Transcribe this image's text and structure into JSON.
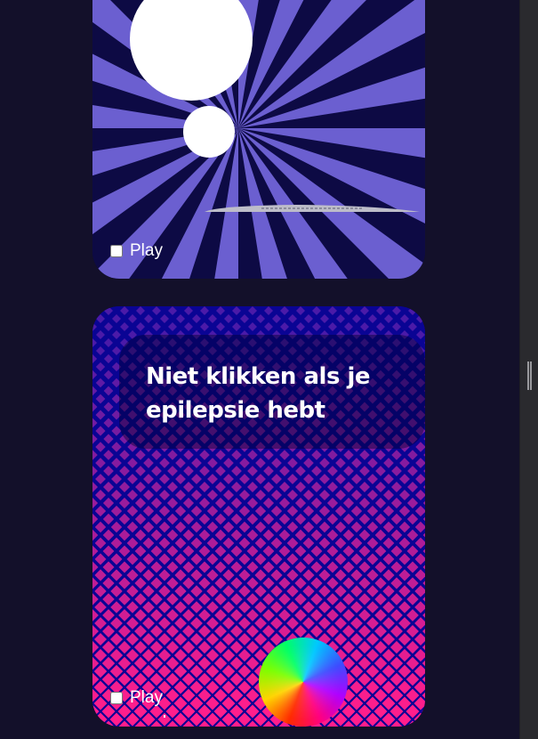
{
  "cards": [
    {
      "play_label": "Play",
      "colors": {
        "background": "#0d0a44",
        "rays": "#6b5fd0",
        "circles": "#ffffff"
      }
    },
    {
      "play_label": "Play",
      "warning_text": "Niet klikken als je epilepsie hebt",
      "colors": {
        "background": "#0a0494",
        "diamond_top": "#4b1aa8",
        "diamond_bottom": "#ff1e8c"
      }
    }
  ]
}
